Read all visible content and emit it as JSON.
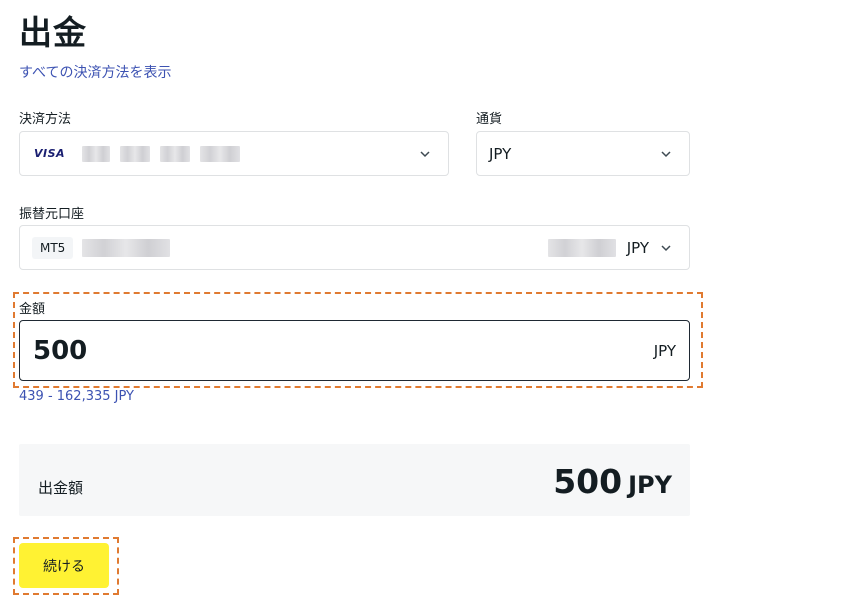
{
  "page": {
    "title": "出金",
    "all_methods_link": "すべての決済方法を表示"
  },
  "payment_method": {
    "label": "決済方法",
    "card_brand": "VISA"
  },
  "currency": {
    "label": "通貨",
    "value": "JPY"
  },
  "source_account": {
    "label": "振替元口座",
    "platform_badge": "MT5",
    "currency": "JPY"
  },
  "amount": {
    "label": "金額",
    "value": "500",
    "currency": "JPY",
    "range_hint": "439 - 162,335 JPY"
  },
  "summary": {
    "label": "出金額",
    "amount": "500",
    "currency": "JPY"
  },
  "actions": {
    "continue_label": "続ける"
  },
  "colors": {
    "accent_yellow": "#fff233",
    "link_blue": "#3c52b2",
    "highlight_orange": "#e07a31",
    "summary_bg": "#f6f7f8"
  },
  "icons": [
    "chevron-down-icon",
    "visa-logo-icon"
  ]
}
